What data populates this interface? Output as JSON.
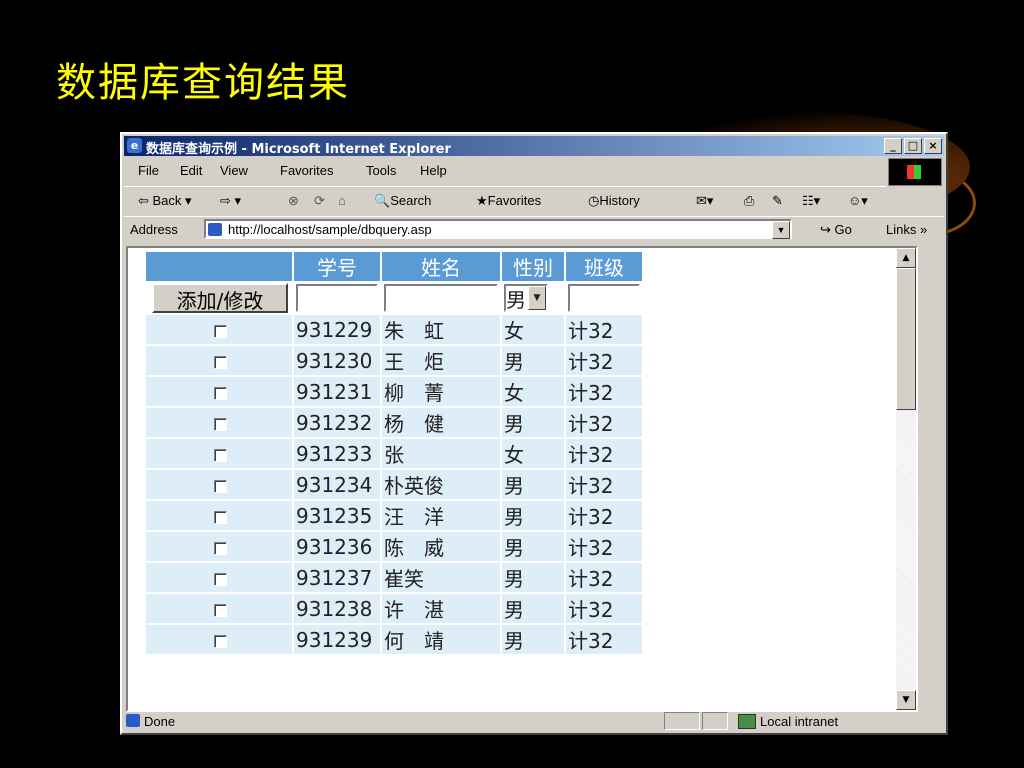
{
  "slide": {
    "title": "数据库查询结果"
  },
  "window": {
    "title": "数据库查询示例 - Microsoft Internet Explorer",
    "controls": [
      "_",
      "□",
      "×"
    ]
  },
  "menu": [
    "File",
    "Edit",
    "View",
    "Favorites",
    "Tools",
    "Help"
  ],
  "toolbar": {
    "back": "⇦ Back ▾",
    "forward": "⇨ ▾",
    "search": "Search",
    "favorites": "Favorites",
    "history": "History"
  },
  "address": {
    "label": "Address",
    "url": "http://localhost/sample/dbquery.asp",
    "go": "Go",
    "links": "Links »"
  },
  "table": {
    "headers": [
      "",
      "学号",
      "姓名",
      "性别",
      "班级"
    ],
    "add_button": "添加/修改",
    "gender_select": "男",
    "rows": [
      {
        "id": "931229",
        "name": "朱　虹",
        "gender": "女",
        "class": "计32"
      },
      {
        "id": "931230",
        "name": "王　炬",
        "gender": "男",
        "class": "计32"
      },
      {
        "id": "931231",
        "name": "柳　菁",
        "gender": "女",
        "class": "计32"
      },
      {
        "id": "931232",
        "name": "杨　健",
        "gender": "男",
        "class": "计32"
      },
      {
        "id": "931233",
        "name": "张",
        "gender": "女",
        "class": "计32"
      },
      {
        "id": "931234",
        "name": "朴英俊",
        "gender": "男",
        "class": "计32"
      },
      {
        "id": "931235",
        "name": "汪　洋",
        "gender": "男",
        "class": "计32"
      },
      {
        "id": "931236",
        "name": "陈　威",
        "gender": "男",
        "class": "计32"
      },
      {
        "id": "931237",
        "name": "崔笑",
        "gender": "男",
        "class": "计32"
      },
      {
        "id": "931238",
        "name": "许　湛",
        "gender": "男",
        "class": "计32"
      },
      {
        "id": "931239",
        "name": "何　靖",
        "gender": "男",
        "class": "计32"
      }
    ]
  },
  "status": {
    "text": "Done",
    "zone": "Local intranet"
  }
}
